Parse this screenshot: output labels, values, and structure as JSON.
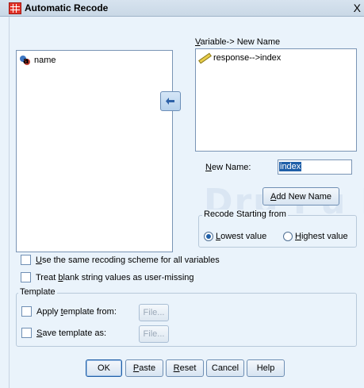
{
  "window": {
    "title": "Automatic Recode",
    "close_glyph": "X"
  },
  "source_list": {
    "items": [
      {
        "label": "name",
        "icon": "string-variable-icon"
      }
    ]
  },
  "target_list": {
    "label_underline": "V",
    "label_rest": "ariable-> New Name",
    "items": [
      {
        "label": "response-->index",
        "icon": "scale-variable-icon"
      }
    ]
  },
  "new_name": {
    "label_underline": "N",
    "label_rest": "ew Name:",
    "value": "index"
  },
  "add_new_name_button": {
    "underline": "A",
    "rest": "dd New Name"
  },
  "recode_starting": {
    "legend": "Recode Starting from",
    "options": [
      {
        "underline": "L",
        "rest": "owest value",
        "selected": true
      },
      {
        "underline": "H",
        "rest": "ighest value",
        "selected": false
      }
    ]
  },
  "options": [
    {
      "underline": "U",
      "rest": "se the same recoding scheme for all variables",
      "checked": false
    },
    {
      "prefix": "Treat ",
      "underline": "b",
      "rest": "lank string values as user-missing",
      "checked": false
    }
  ],
  "template": {
    "legend": "Template",
    "apply": {
      "prefix": "Apply ",
      "underline": "t",
      "rest": "emplate from:",
      "checked": false
    },
    "save": {
      "underline": "S",
      "rest": "ave template as:",
      "checked": false
    },
    "file_button_label": "File..."
  },
  "buttons": {
    "ok": "OK",
    "paste": {
      "underline": "P",
      "rest": "aste"
    },
    "reset": {
      "underline": "R",
      "rest": "eset"
    },
    "cancel": "Cancel",
    "help": "Help"
  },
  "watermark": "Dru Pu Boo",
  "colors": {
    "accent": "#1f5fa8",
    "background": "#eaf3fb",
    "border": "#7a95b5"
  }
}
